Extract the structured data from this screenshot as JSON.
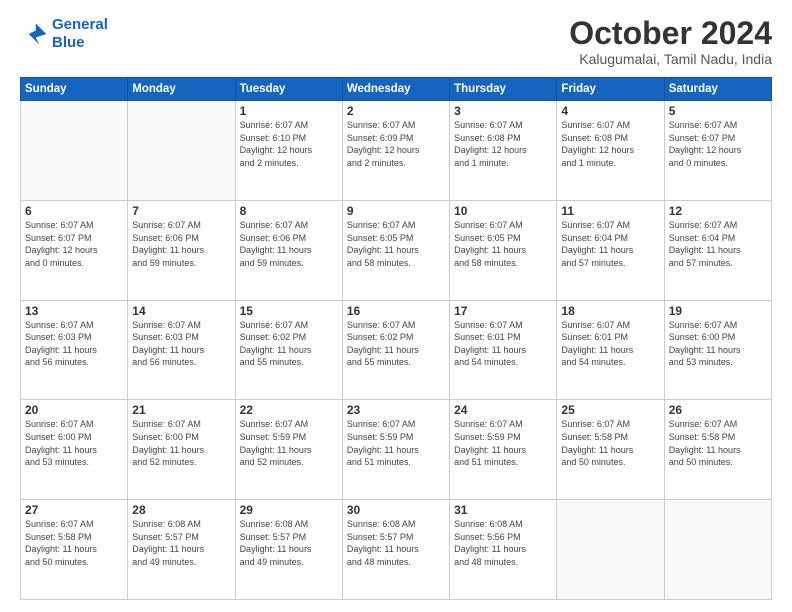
{
  "header": {
    "logo_line1": "General",
    "logo_line2": "Blue",
    "month": "October 2024",
    "location": "Kalugumalai, Tamil Nadu, India"
  },
  "weekdays": [
    "Sunday",
    "Monday",
    "Tuesday",
    "Wednesday",
    "Thursday",
    "Friday",
    "Saturday"
  ],
  "weeks": [
    [
      {
        "day": "",
        "info": ""
      },
      {
        "day": "",
        "info": ""
      },
      {
        "day": "1",
        "info": "Sunrise: 6:07 AM\nSunset: 6:10 PM\nDaylight: 12 hours\nand 2 minutes."
      },
      {
        "day": "2",
        "info": "Sunrise: 6:07 AM\nSunset: 6:09 PM\nDaylight: 12 hours\nand 2 minutes."
      },
      {
        "day": "3",
        "info": "Sunrise: 6:07 AM\nSunset: 6:08 PM\nDaylight: 12 hours\nand 1 minute."
      },
      {
        "day": "4",
        "info": "Sunrise: 6:07 AM\nSunset: 6:08 PM\nDaylight: 12 hours\nand 1 minute."
      },
      {
        "day": "5",
        "info": "Sunrise: 6:07 AM\nSunset: 6:07 PM\nDaylight: 12 hours\nand 0 minutes."
      }
    ],
    [
      {
        "day": "6",
        "info": "Sunrise: 6:07 AM\nSunset: 6:07 PM\nDaylight: 12 hours\nand 0 minutes."
      },
      {
        "day": "7",
        "info": "Sunrise: 6:07 AM\nSunset: 6:06 PM\nDaylight: 11 hours\nand 59 minutes."
      },
      {
        "day": "8",
        "info": "Sunrise: 6:07 AM\nSunset: 6:06 PM\nDaylight: 11 hours\nand 59 minutes."
      },
      {
        "day": "9",
        "info": "Sunrise: 6:07 AM\nSunset: 6:05 PM\nDaylight: 11 hours\nand 58 minutes."
      },
      {
        "day": "10",
        "info": "Sunrise: 6:07 AM\nSunset: 6:05 PM\nDaylight: 11 hours\nand 58 minutes."
      },
      {
        "day": "11",
        "info": "Sunrise: 6:07 AM\nSunset: 6:04 PM\nDaylight: 11 hours\nand 57 minutes."
      },
      {
        "day": "12",
        "info": "Sunrise: 6:07 AM\nSunset: 6:04 PM\nDaylight: 11 hours\nand 57 minutes."
      }
    ],
    [
      {
        "day": "13",
        "info": "Sunrise: 6:07 AM\nSunset: 6:03 PM\nDaylight: 11 hours\nand 56 minutes."
      },
      {
        "day": "14",
        "info": "Sunrise: 6:07 AM\nSunset: 6:03 PM\nDaylight: 11 hours\nand 56 minutes."
      },
      {
        "day": "15",
        "info": "Sunrise: 6:07 AM\nSunset: 6:02 PM\nDaylight: 11 hours\nand 55 minutes."
      },
      {
        "day": "16",
        "info": "Sunrise: 6:07 AM\nSunset: 6:02 PM\nDaylight: 11 hours\nand 55 minutes."
      },
      {
        "day": "17",
        "info": "Sunrise: 6:07 AM\nSunset: 6:01 PM\nDaylight: 11 hours\nand 54 minutes."
      },
      {
        "day": "18",
        "info": "Sunrise: 6:07 AM\nSunset: 6:01 PM\nDaylight: 11 hours\nand 54 minutes."
      },
      {
        "day": "19",
        "info": "Sunrise: 6:07 AM\nSunset: 6:00 PM\nDaylight: 11 hours\nand 53 minutes."
      }
    ],
    [
      {
        "day": "20",
        "info": "Sunrise: 6:07 AM\nSunset: 6:00 PM\nDaylight: 11 hours\nand 53 minutes."
      },
      {
        "day": "21",
        "info": "Sunrise: 6:07 AM\nSunset: 6:00 PM\nDaylight: 11 hours\nand 52 minutes."
      },
      {
        "day": "22",
        "info": "Sunrise: 6:07 AM\nSunset: 5:59 PM\nDaylight: 11 hours\nand 52 minutes."
      },
      {
        "day": "23",
        "info": "Sunrise: 6:07 AM\nSunset: 5:59 PM\nDaylight: 11 hours\nand 51 minutes."
      },
      {
        "day": "24",
        "info": "Sunrise: 6:07 AM\nSunset: 5:59 PM\nDaylight: 11 hours\nand 51 minutes."
      },
      {
        "day": "25",
        "info": "Sunrise: 6:07 AM\nSunset: 5:58 PM\nDaylight: 11 hours\nand 50 minutes."
      },
      {
        "day": "26",
        "info": "Sunrise: 6:07 AM\nSunset: 5:58 PM\nDaylight: 11 hours\nand 50 minutes."
      }
    ],
    [
      {
        "day": "27",
        "info": "Sunrise: 6:07 AM\nSunset: 5:58 PM\nDaylight: 11 hours\nand 50 minutes."
      },
      {
        "day": "28",
        "info": "Sunrise: 6:08 AM\nSunset: 5:57 PM\nDaylight: 11 hours\nand 49 minutes."
      },
      {
        "day": "29",
        "info": "Sunrise: 6:08 AM\nSunset: 5:57 PM\nDaylight: 11 hours\nand 49 minutes."
      },
      {
        "day": "30",
        "info": "Sunrise: 6:08 AM\nSunset: 5:57 PM\nDaylight: 11 hours\nand 48 minutes."
      },
      {
        "day": "31",
        "info": "Sunrise: 6:08 AM\nSunset: 5:56 PM\nDaylight: 11 hours\nand 48 minutes."
      },
      {
        "day": "",
        "info": ""
      },
      {
        "day": "",
        "info": ""
      }
    ]
  ]
}
